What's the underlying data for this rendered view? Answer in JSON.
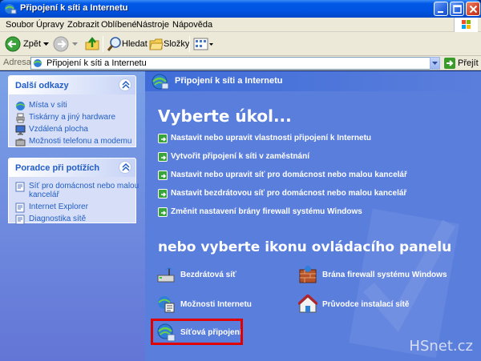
{
  "window": {
    "title": "Připojení k síti a Internetu",
    "title_icon": "network-connections-icon"
  },
  "menubar": {
    "items": [
      "Soubor",
      "Úpravy",
      "Zobrazit",
      "Oblíbené",
      "Nástroje",
      "Nápověda"
    ]
  },
  "toolbar": {
    "back_label": "Zpět",
    "search_label": "Hledat",
    "folders_label": "Složky"
  },
  "address": {
    "label": "Adresa",
    "value": "Připojení k síti a Internetu",
    "go_label": "Přejít"
  },
  "sidebar": {
    "panels": [
      {
        "title": "Další odkazy",
        "items": [
          {
            "label": "Místa v síti",
            "icon": "network-places-icon"
          },
          {
            "label": "Tiskárny a jiný hardware",
            "icon": "printer-icon"
          },
          {
            "label": "Vzdálená plocha",
            "icon": "remote-desktop-icon"
          },
          {
            "label": "Možnosti telefonu a modemu",
            "icon": "phone-modem-icon"
          }
        ]
      },
      {
        "title": "Poradce při potížích",
        "items": [
          {
            "label": "Síť pro domácnost nebo malou",
            "label2": "kancelář",
            "icon": "help-icon"
          },
          {
            "label": "Internet Explorer",
            "icon": "help-icon"
          },
          {
            "label": "Diagnostika sítě",
            "icon": "help-icon"
          }
        ]
      }
    ]
  },
  "main": {
    "header": "Připojení k síti a Internetu",
    "task_heading": "Vyberte úkol...",
    "tasks": [
      "Nastavit nebo upravit vlastnosti připojení k Internetu",
      "Vytvořit připojení k síti v zaměstnání",
      "Nastavit nebo upravit síť pro domácnost nebo malou kancelář",
      "Nastavit bezdrátovou síť pro domácnost nebo malou kancelář",
      "Změnit nastavení brány firewall systému Windows"
    ],
    "icon_heading": "nebo vyberte ikonu ovládacího panelu",
    "icons": [
      {
        "label": "Bezdrátová síť",
        "icon": "wireless-network-icon"
      },
      {
        "label": "Brána firewall systému Windows",
        "icon": "firewall-icon"
      },
      {
        "label": "Možnosti Internetu",
        "icon": "internet-options-icon"
      },
      {
        "label": "Průvodce instalací sítě",
        "icon": "network-setup-wizard-icon"
      },
      {
        "label": "Síťová připojení",
        "icon": "network-connections-icon"
      }
    ]
  },
  "watermark": "HSnet.cz",
  "colors": {
    "titlebar": "#0054e3",
    "left_pane": "#7ba2e7",
    "right_pane": "#5a7edc",
    "link": "#215dc6",
    "highlight": "#e00000"
  }
}
